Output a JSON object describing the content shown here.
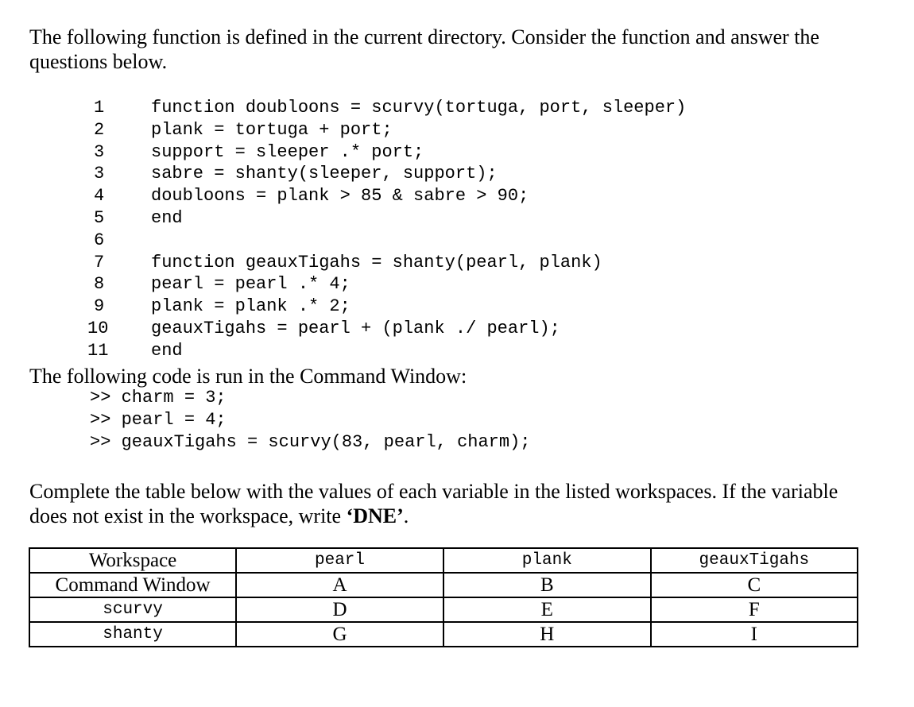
{
  "intro": {
    "text": "The following function is defined in the current directory. Consider the function and answer the questions below."
  },
  "code": {
    "lines": [
      {
        "num": "1",
        "text": "function doubloons = scurvy(tortuga, port, sleeper)"
      },
      {
        "num": "2",
        "text": "plank = tortuga + port;"
      },
      {
        "num": "3",
        "text": "support = sleeper .* port;"
      },
      {
        "num": "3",
        "text": "sabre = shanty(sleeper, support);"
      },
      {
        "num": "4",
        "text": "doubloons = plank > 85 & sabre > 90;"
      },
      {
        "num": "5",
        "text": "end"
      },
      {
        "num": "6",
        "text": ""
      },
      {
        "num": "7",
        "text": "function geauxTigahs = shanty(pearl, plank)"
      },
      {
        "num": "8",
        "text": "pearl = pearl .* 4;"
      },
      {
        "num": "9",
        "text": "plank = plank .* 2;"
      },
      {
        "num": "10",
        "text": "geauxTigahs = pearl + (plank ./ pearl);"
      },
      {
        "num": "11",
        "text": "end"
      }
    ]
  },
  "command_window": {
    "heading": "The following code is run in the Command Window:",
    "lines": [
      ">> charm = 3;",
      ">> pearl = 4;",
      ">> geauxTigahs = scurvy(83, pearl, charm);"
    ]
  },
  "instructions": {
    "text_before": "Complete the table below with the values of each variable in the listed workspaces. If the variable does not exist in the workspace, write ",
    "emphasis": "‘DNE’",
    "text_after": "."
  },
  "table": {
    "headers": [
      "Workspace",
      "pearl",
      "plank",
      "geauxTigahs"
    ],
    "rows": [
      {
        "workspace": "Command Window",
        "cells": [
          "A",
          "B",
          "C"
        ]
      },
      {
        "workspace": "scurvy",
        "cells": [
          "D",
          "E",
          "F"
        ]
      },
      {
        "workspace": "shanty",
        "cells": [
          "G",
          "H",
          "I"
        ]
      }
    ]
  }
}
